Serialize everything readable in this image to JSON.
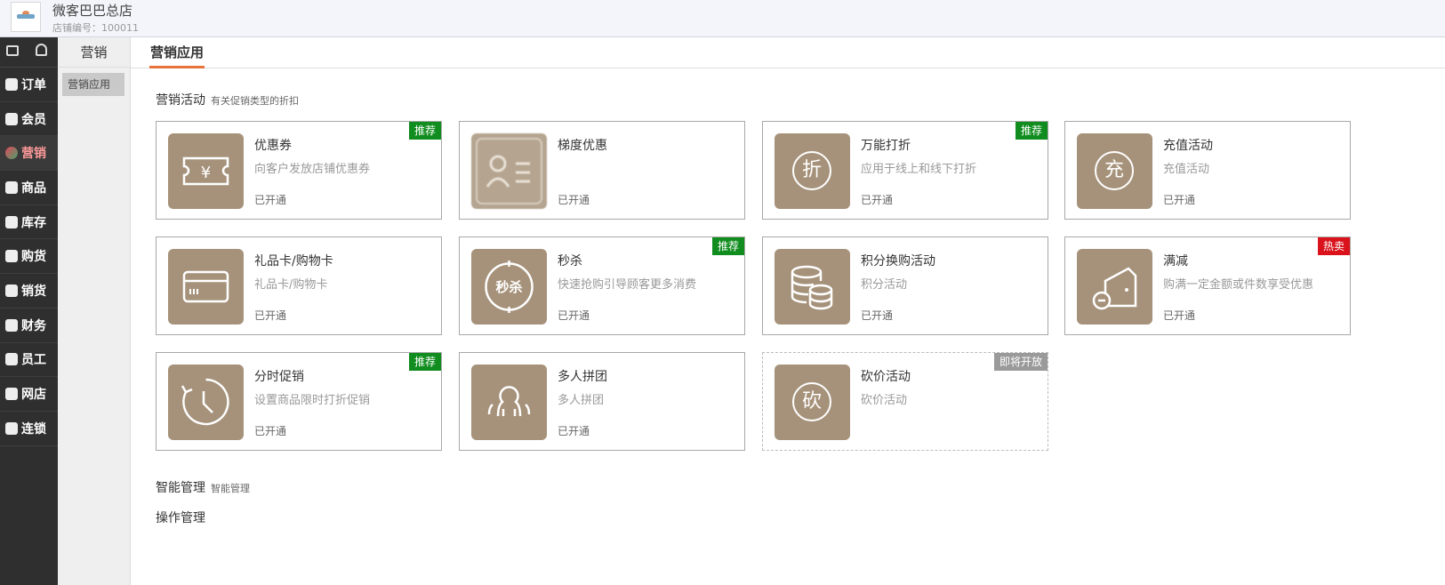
{
  "header": {
    "shop_name": "微客巴巴总店",
    "shop_id": "店铺编号：100011"
  },
  "leftnav": {
    "items": [
      {
        "label": "订单",
        "icon": "order-icon"
      },
      {
        "label": "会员",
        "icon": "member-icon"
      },
      {
        "label": "营销",
        "icon": "marketing-icon",
        "active": true
      },
      {
        "label": "商品",
        "icon": "goods-icon"
      },
      {
        "label": "库存",
        "icon": "inventory-icon"
      },
      {
        "label": "购货",
        "icon": "purchase-icon"
      },
      {
        "label": "销货",
        "icon": "sales-icon"
      },
      {
        "label": "财务",
        "icon": "finance-icon"
      },
      {
        "label": "员工",
        "icon": "staff-icon"
      },
      {
        "label": "网店",
        "icon": "webshop-icon"
      },
      {
        "label": "连锁",
        "icon": "chain-icon"
      }
    ]
  },
  "subnav": {
    "title": "营销",
    "items": [
      "营销应用"
    ]
  },
  "tabs": [
    "营销应用"
  ],
  "sections": {
    "activities": {
      "title": "营销活动",
      "subtitle": "有关促销类型的折扣"
    },
    "smart": {
      "title": "智能管理",
      "subtitle": "智能管理"
    },
    "operation": {
      "title": "操作管理"
    }
  },
  "cards": [
    {
      "title": "优惠券",
      "desc": "向客户发放店铺优惠券",
      "status": "已开通",
      "badge": "推荐",
      "icon": "coupon-icon"
    },
    {
      "title": "梯度优惠",
      "desc": "",
      "status": "已开通",
      "badge": "",
      "icon": "id-card-icon"
    },
    {
      "title": "万能打折",
      "desc": "应用于线上和线下打折",
      "status": "已开通",
      "badge": "推荐",
      "icon": "discount-icon",
      "glyph": "折"
    },
    {
      "title": "充值活动",
      "desc": "充值活动",
      "status": "已开通",
      "badge": "",
      "icon": "recharge-icon",
      "glyph": "充"
    },
    {
      "title": "礼品卡/购物卡",
      "desc": "礼品卡/购物卡",
      "status": "已开通",
      "badge": "",
      "icon": "gift-card-icon"
    },
    {
      "title": "秒杀",
      "desc": "快速抢购引导顾客更多消费",
      "status": "已开通",
      "badge": "推荐",
      "icon": "flash-sale-icon",
      "glyph": "秒杀"
    },
    {
      "title": "积分换购活动",
      "desc": "积分活动",
      "status": "已开通",
      "badge": "",
      "icon": "points-icon"
    },
    {
      "title": "满减",
      "desc": "购满一定金额或件数享受优惠",
      "status": "已开通",
      "badge": "热卖",
      "icon": "wallet-icon"
    },
    {
      "title": "分时促销",
      "desc": "设置商品限时打折促销",
      "status": "已开通",
      "badge": "推荐",
      "icon": "timer-icon"
    },
    {
      "title": "多人拼团",
      "desc": "多人拼团",
      "status": "已开通",
      "badge": "",
      "icon": "group-icon"
    },
    {
      "title": "砍价活动",
      "desc": "砍价活动",
      "status": "",
      "badge": "即将开放",
      "icon": "bargain-icon",
      "glyph": "砍"
    }
  ]
}
